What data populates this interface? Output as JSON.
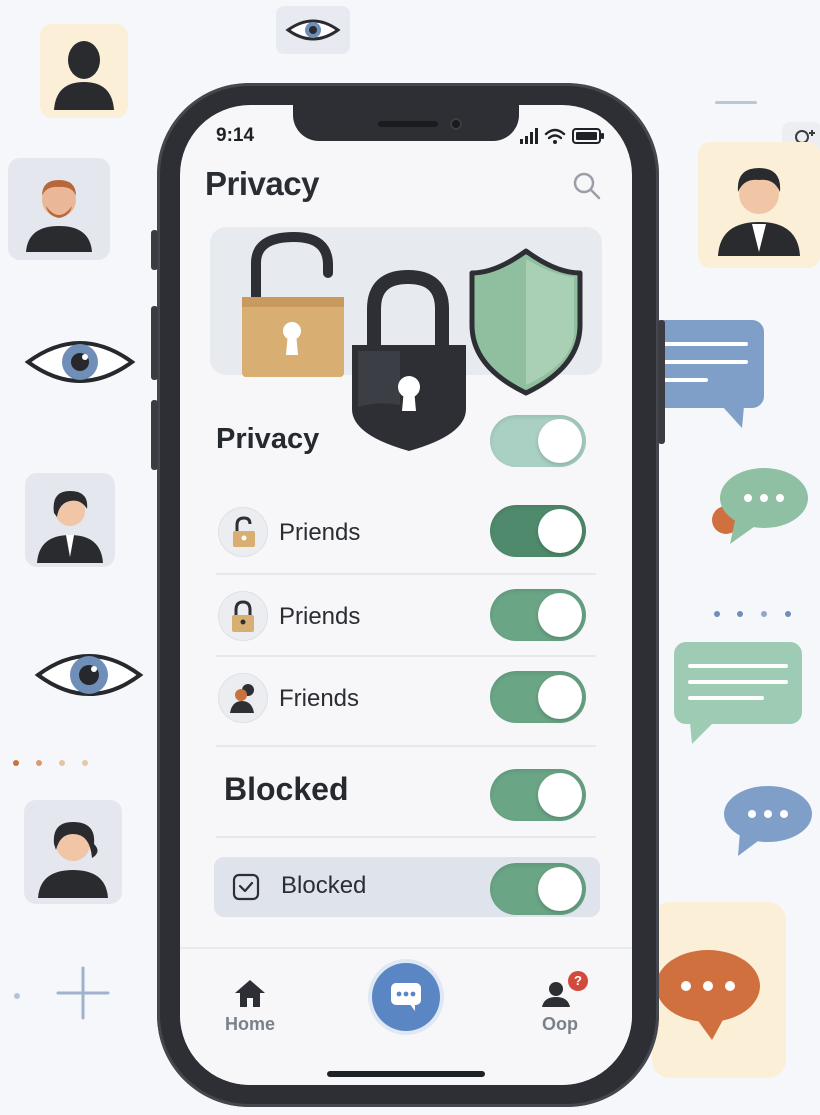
{
  "status_bar": {
    "time": "9:14"
  },
  "header": {
    "title": "Privacy"
  },
  "sections": {
    "privacy": {
      "title": "Privacy",
      "toggle_on": true
    },
    "blocked": {
      "title": "Blocked",
      "toggle_on": true
    }
  },
  "rows": [
    {
      "label": "Priends",
      "icon": "padlock-icon",
      "toggle_on": true
    },
    {
      "label": "Priends",
      "icon": "padlock-icon",
      "toggle_on": true
    },
    {
      "label": "Friends",
      "icon": "person-icon",
      "toggle_on": true
    }
  ],
  "blocked_item": {
    "label": "Blocked",
    "icon": "checkbox-icon",
    "toggle_on": true
  },
  "tabbar": {
    "home_label": "Home",
    "chat_icon": "chat-bubble-icon",
    "profile_label": "Oop",
    "badge_text": "?"
  },
  "colors": {
    "toggle_on": "#6aa586",
    "toggle_dark": "#4f8a6c",
    "toggle_light": "#a9d0c3",
    "accent_blue": "#5a86c4",
    "gold": "#d8ae73",
    "shield": "#8fbf9f"
  }
}
